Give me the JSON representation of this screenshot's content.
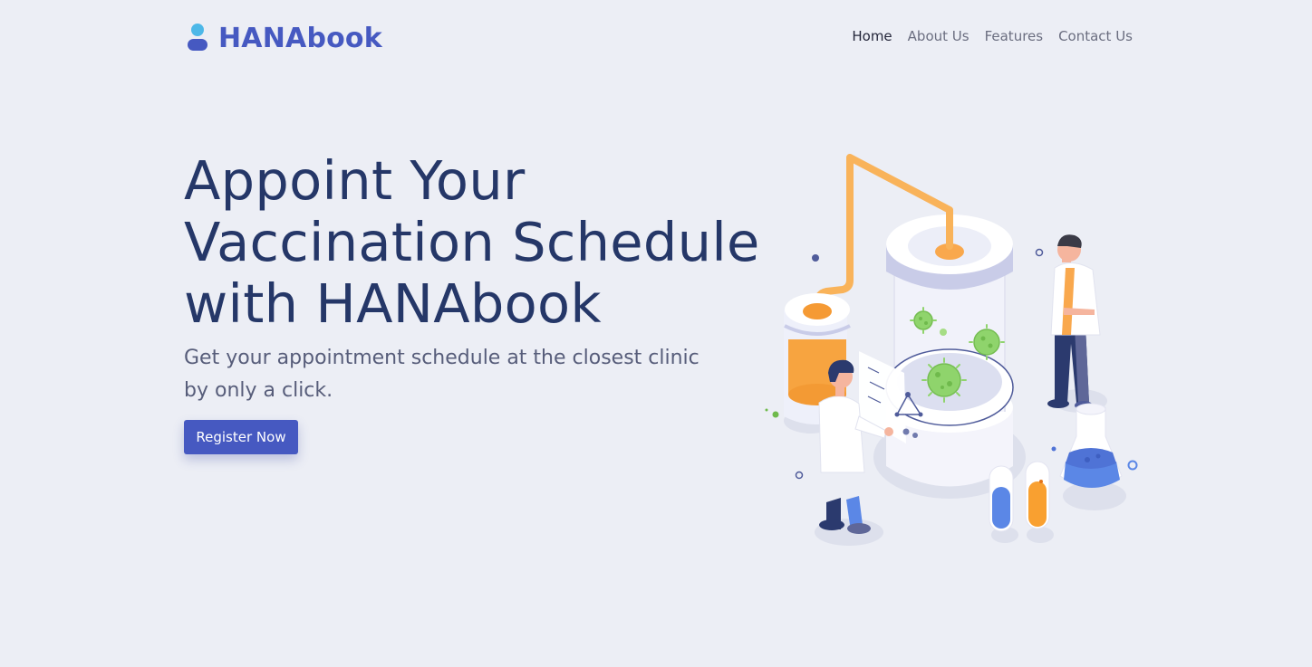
{
  "brand": {
    "name": "HANAbook",
    "color": "#4659c1"
  },
  "nav": {
    "items": [
      {
        "label": "Home",
        "active": true
      },
      {
        "label": "About Us",
        "active": false
      },
      {
        "label": "Features",
        "active": false
      },
      {
        "label": "Contact Us",
        "active": false
      }
    ]
  },
  "hero": {
    "title": "Appoint Your Vaccination Schedule with HANAbook",
    "subtitle": "Get your appointment schedule at the closest clinic by only a click.",
    "cta_label": "Register Now"
  },
  "illustration": {
    "icon": "laboratory-vaccine-illustration",
    "colors": {
      "accent_orange": "#f9a84d",
      "virus_green": "#8fd46c",
      "liquid_blue": "#5b87e6",
      "ink": "#2b3a6e"
    }
  }
}
